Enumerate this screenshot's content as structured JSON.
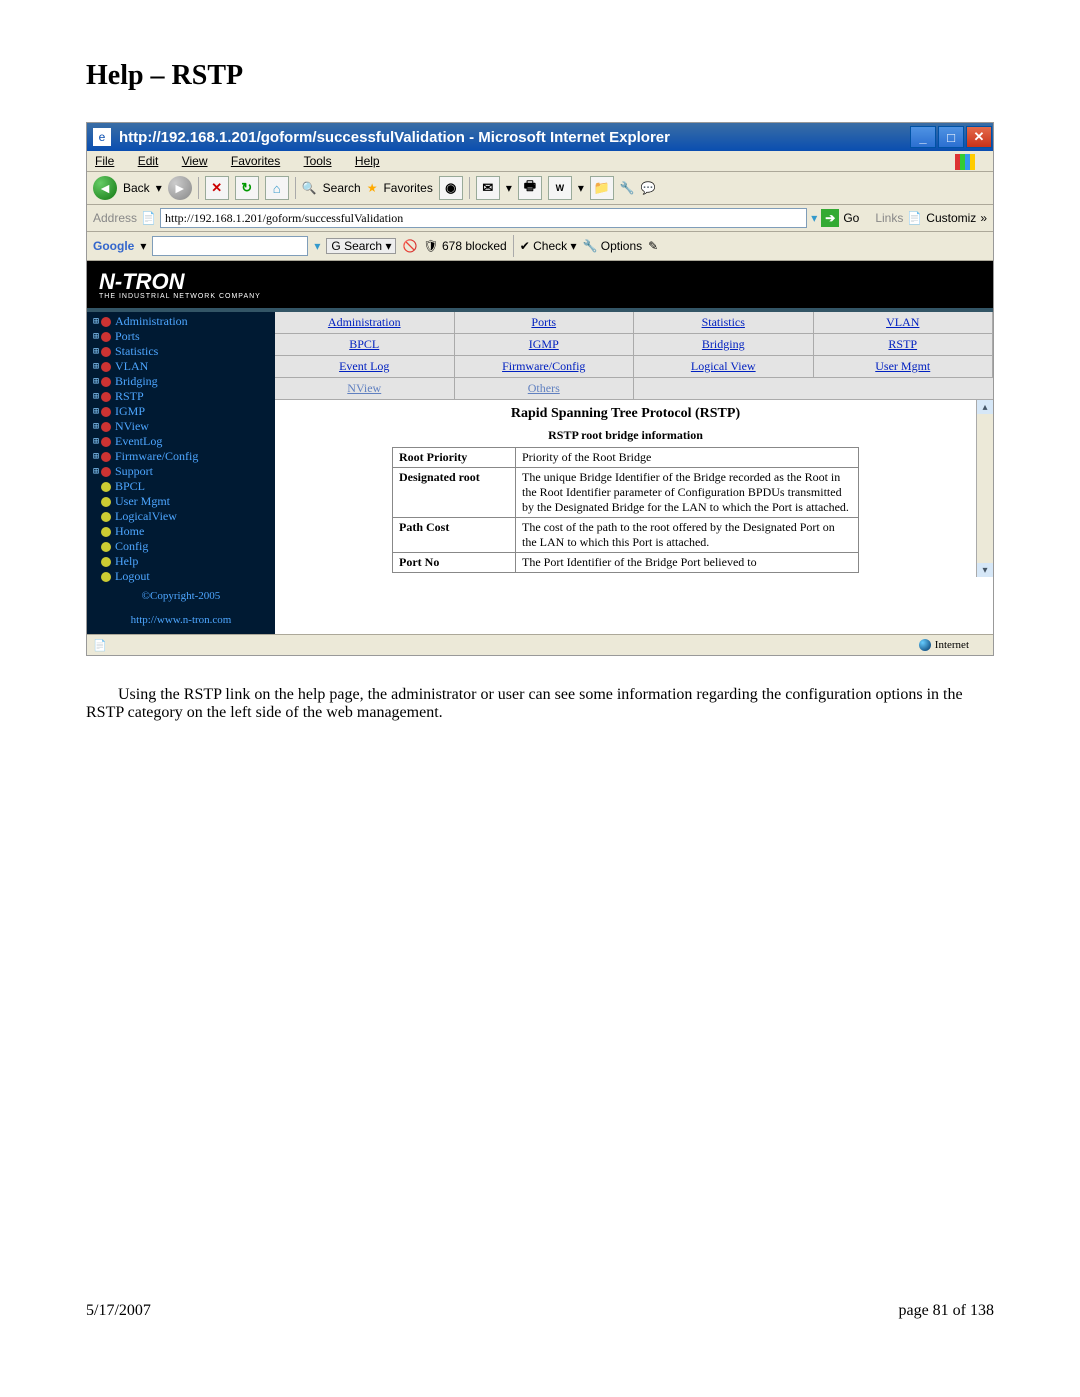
{
  "heading": "Help – RSTP",
  "titlebar": "http://192.168.1.201/goform/successfulValidation - Microsoft Internet Explorer",
  "menubar": [
    "File",
    "Edit",
    "View",
    "Favorites",
    "Tools",
    "Help"
  ],
  "toolbar": {
    "back": "Back",
    "search": "Search",
    "fav": "Favorites"
  },
  "addressbar": {
    "label": "Address",
    "url": "http://192.168.1.201/goform/successfulValidation",
    "go": "Go",
    "links": "Links",
    "custom": "Customiz"
  },
  "googlebar": {
    "brand": "Google",
    "search": "Search",
    "blocked": "678 blocked",
    "check": "Check",
    "options": "Options"
  },
  "brand": {
    "name": "N-TRON",
    "sub": "THE INDUSTRIAL NETWORK COMPANY"
  },
  "tree": {
    "expandable": [
      {
        "label": "Administration"
      },
      {
        "label": "Ports"
      },
      {
        "label": "Statistics"
      },
      {
        "label": "VLAN"
      },
      {
        "label": "Bridging"
      },
      {
        "label": "RSTP"
      },
      {
        "label": "IGMP"
      },
      {
        "label": "NView"
      },
      {
        "label": "EventLog"
      },
      {
        "label": "Firmware/Config"
      },
      {
        "label": "Support"
      }
    ],
    "leaves": [
      "BPCL",
      "User Mgmt",
      "LogicalView",
      "Home",
      "Config",
      "Help",
      "Logout"
    ],
    "copyright": "©Copyright-2005",
    "url": "http://www.n-tron.com"
  },
  "tabs": {
    "row1": [
      "Administration",
      "Ports",
      "Statistics",
      "VLAN"
    ],
    "row2": [
      "BPCL",
      "IGMP",
      "Bridging",
      "RSTP"
    ],
    "row3": [
      "Event Log",
      "Firmware/Config",
      "Logical View",
      "User Mgmt"
    ],
    "row4": [
      "NView",
      "Others",
      "",
      ""
    ]
  },
  "panel": {
    "title": "Rapid Spanning Tree Protocol (RSTP)",
    "subtitle": "RSTP root bridge information",
    "rows": [
      {
        "k": "Root Priority",
        "v": "Priority of the Root Bridge"
      },
      {
        "k": "Designated root",
        "v": "The unique Bridge Identifier of the Bridge recorded as the Root in the Root Identifier parameter of Configuration BPDUs transmitted by the Designated Bridge for the LAN to which the Port is attached."
      },
      {
        "k": "Path Cost",
        "v": "The cost of the path to the root offered by the Designated Port on the LAN to which this Port is attached."
      },
      {
        "k": "Port No",
        "v": "The Port Identifier of the Bridge Port believed to"
      }
    ]
  },
  "status": "Internet",
  "paragraph": "Using the RSTP link on the help page, the administrator or user can see some information regarding the configuration options in the RSTP category on the left side of the web management.",
  "footer": {
    "date": "5/17/2007",
    "page": "page 81 of 138"
  }
}
